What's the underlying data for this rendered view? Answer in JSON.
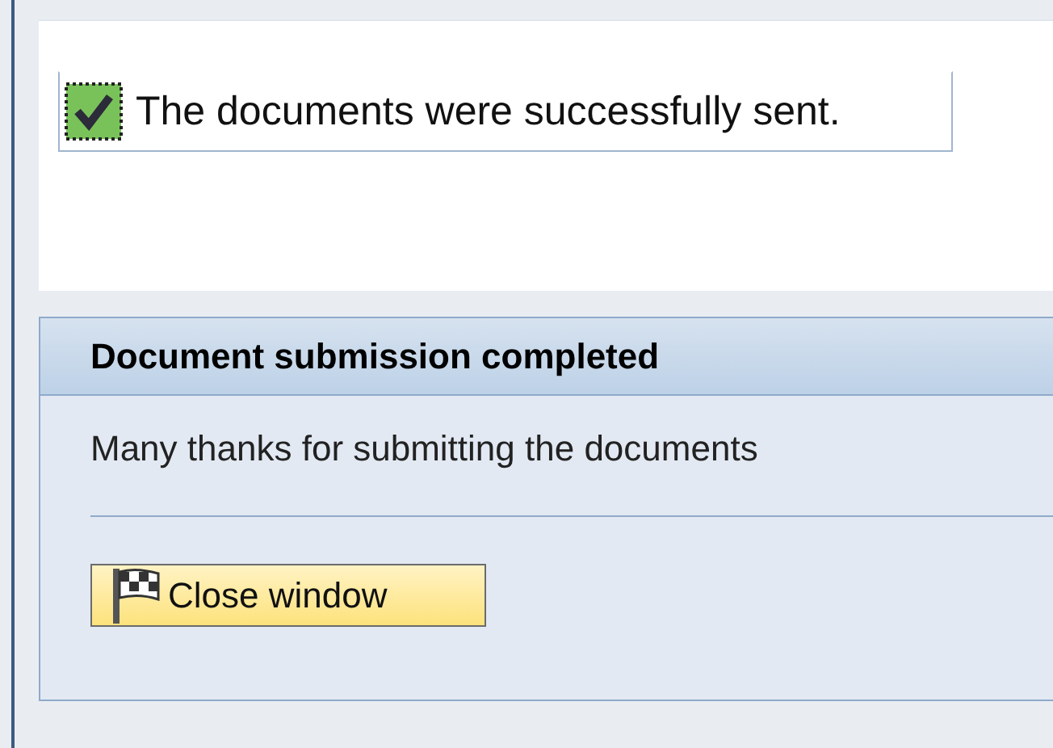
{
  "message": {
    "kind": "success",
    "text": "The documents were successfully sent."
  },
  "panel": {
    "title": "Document submission completed",
    "text": "Many thanks for submitting the documents",
    "button": "Close window"
  }
}
